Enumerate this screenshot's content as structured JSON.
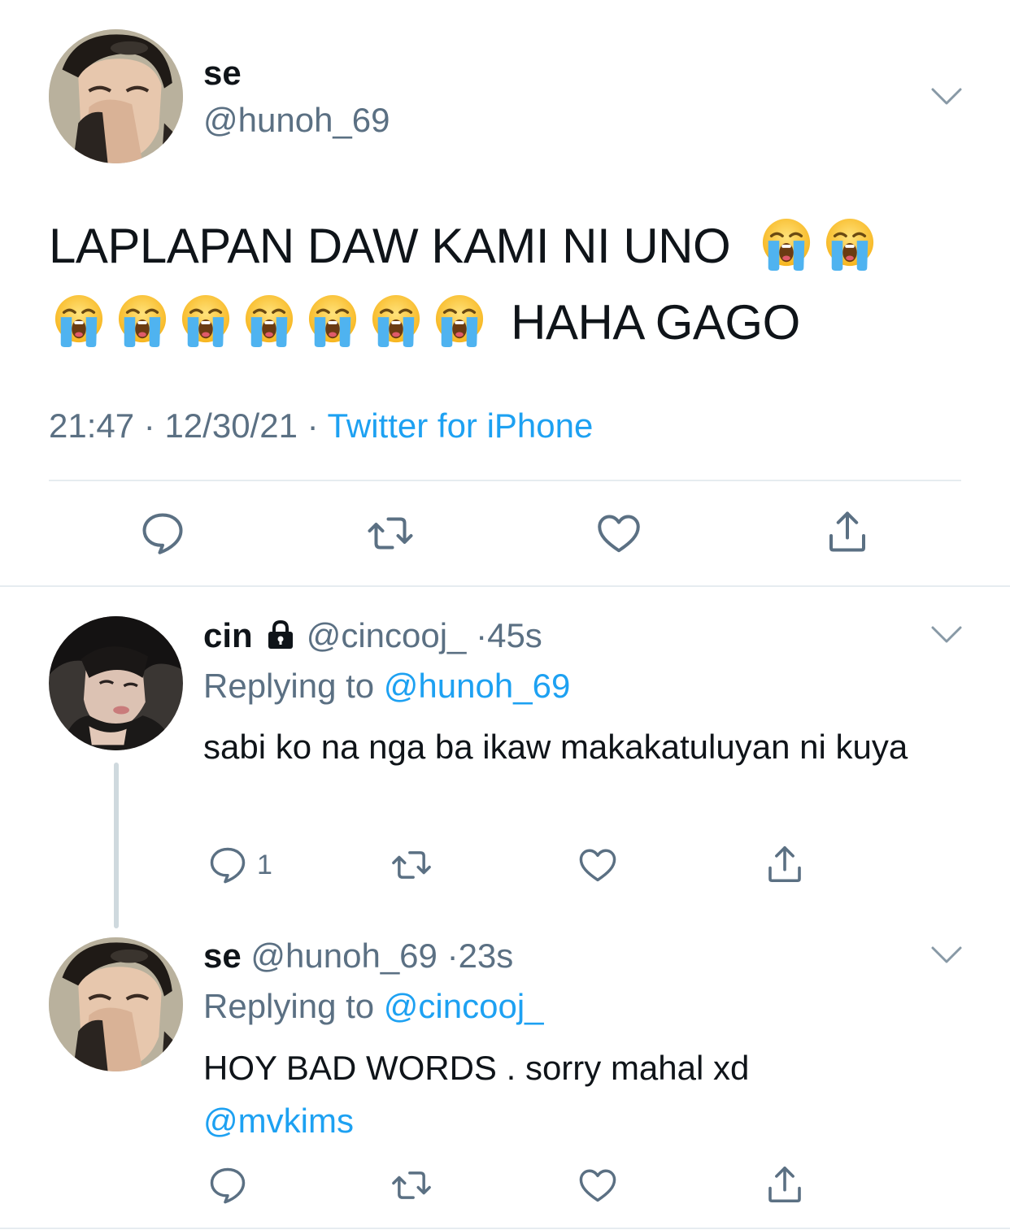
{
  "main_tweet": {
    "author_name": "se",
    "author_handle": "@hunoh_69",
    "text_line1": "LAPLAPAN DAW KAMI NI UNO",
    "text_line2_suffix": "HAHA GAGO",
    "emoji_name": "loudly-crying-face",
    "emoji_count": 9,
    "time": "21:47",
    "date": "12/30/21",
    "separator": "·",
    "source": "Twitter for iPhone"
  },
  "replies": [
    {
      "author_name": "cin",
      "author_handle": "@cincooj_",
      "separator": "·",
      "time_ago": "45s",
      "locked": true,
      "replying_to_prefix": "Replying to",
      "replying_to": "@hunoh_69",
      "text": "sabi ko na nga ba ikaw makakatuluyan ni kuya",
      "reply_count": "1"
    },
    {
      "author_name": "se",
      "author_handle": "@hunoh_69",
      "separator": "·",
      "time_ago": "23s",
      "locked": false,
      "replying_to_prefix": "Replying to",
      "replying_to": "@cincooj_",
      "text": "HOY BAD WORDS . sorry mahal xd",
      "mention": "@mvkims",
      "reply_count": ""
    }
  ],
  "icons": {
    "reply": "reply-icon",
    "retweet": "retweet-icon",
    "like": "heart-icon",
    "share": "share-icon",
    "more": "chevron-down-icon",
    "lock": "lock-icon"
  },
  "colors": {
    "text": "#0f1419",
    "secondary": "#5b7083",
    "link": "#1da1f2",
    "divider": "#e6ecf0",
    "thread_line": "#cfd9de",
    "emoji_face": "#ffcc33",
    "emoji_tears": "#4fb3f0"
  }
}
